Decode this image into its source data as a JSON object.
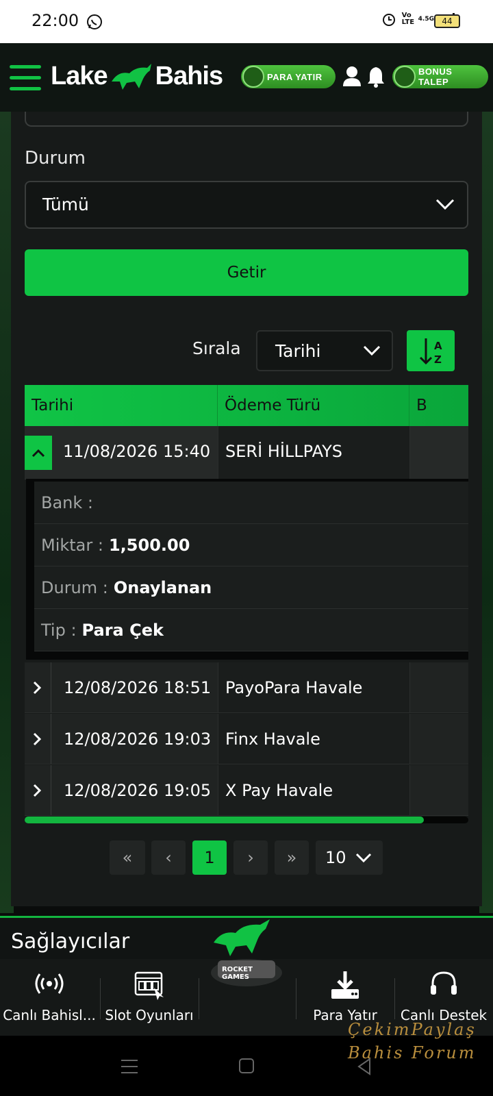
{
  "status_bar": {
    "time": "22:00",
    "network": "4.5G",
    "volte": "Vo LTE",
    "battery": "44"
  },
  "header": {
    "logo_left": "Lake",
    "logo_right": "Bahis",
    "deposit_label": "PARA YATIR",
    "bonus_label": "BONUS TALEP",
    "brand_color": "#0fc444"
  },
  "filters": {
    "status_label": "Durum",
    "status_value": "Tümü",
    "submit_label": "Getir"
  },
  "sort": {
    "label": "Sırala",
    "value": "Tarihi",
    "order_button": "A Z"
  },
  "table": {
    "columns": [
      "Tarihi",
      "Ödeme Türü",
      "B"
    ],
    "rows": [
      {
        "date": "11/08/2026 15:40",
        "method": "SERİ HİLLPAYS",
        "expanded": true
      },
      {
        "date": "12/08/2026 18:51",
        "method": "PayoPara Havale",
        "expanded": false
      },
      {
        "date": "12/08/2026 19:03",
        "method": "Finx Havale",
        "expanded": false
      },
      {
        "date": "12/08/2026 19:05",
        "method": "X Pay Havale",
        "expanded": false
      }
    ],
    "detail": {
      "bank_label": "Bank :",
      "bank_value": "",
      "amount_label": "Miktar :",
      "amount_value": "1,500.00",
      "status_label": "Durum :",
      "status_value": "Onaylanan",
      "type_label": "Tip :",
      "type_value": "Para Çek"
    }
  },
  "pagination": {
    "first": "«",
    "prev": "‹",
    "current": "1",
    "next": "›",
    "last": "»",
    "page_size": "10"
  },
  "providers_title": "Sağlayıcılar",
  "provider_badge": "ROCKET GAMES",
  "bottom_nav": [
    {
      "label": "Canlı Bahisl...",
      "icon": "live-broadcast-icon"
    },
    {
      "label": "Slot Oyunları",
      "icon": "slot-machine-icon"
    },
    {
      "label": "Para Yatır",
      "icon": "download-icon"
    },
    {
      "label": "Canlı Destek",
      "icon": "headset-icon"
    }
  ],
  "watermark": {
    "line1": "ÇekimPaylaş",
    "line2": "Bahis Forum"
  }
}
